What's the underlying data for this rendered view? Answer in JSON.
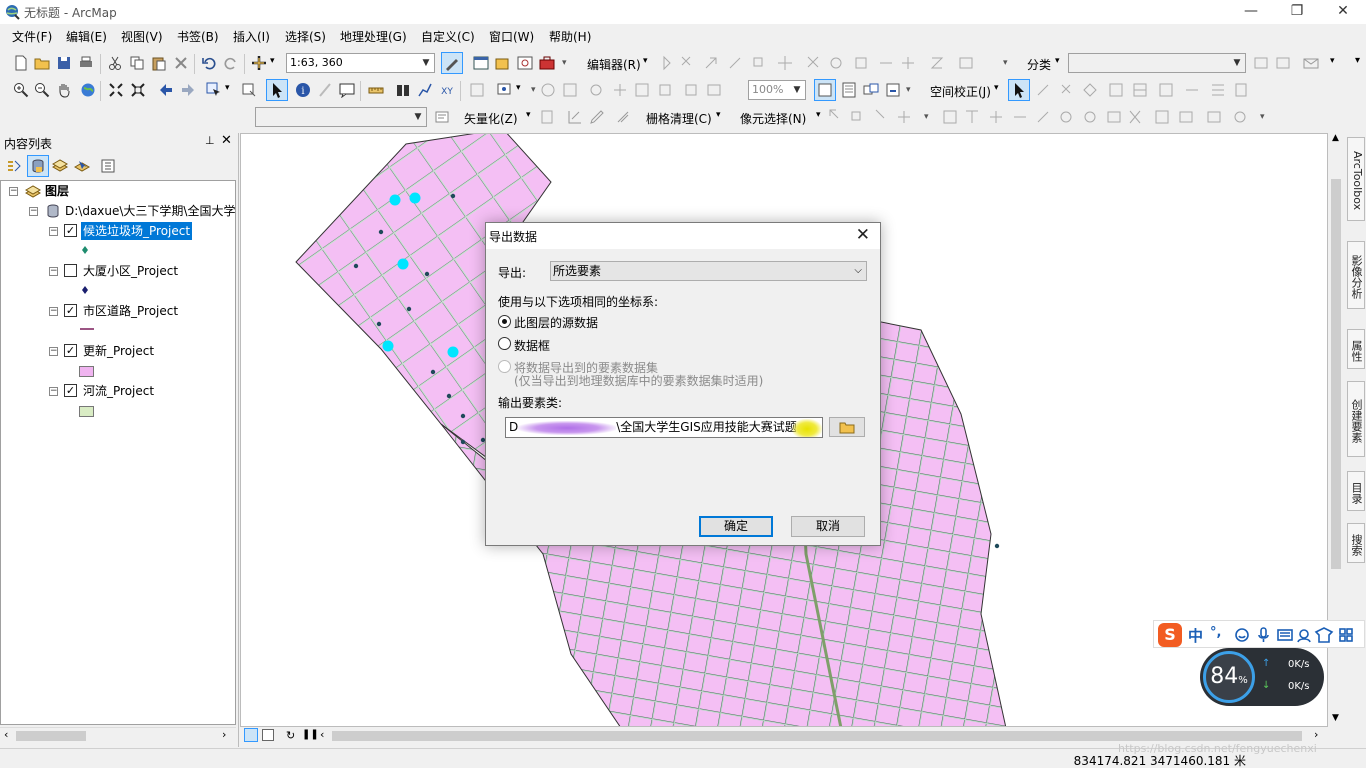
{
  "window": {
    "title": "无标题 - ArcMap"
  },
  "menu": [
    "文件(F)",
    "编辑(E)",
    "视图(V)",
    "书签(B)",
    "插入(I)",
    "选择(S)",
    "地理处理(G)",
    "自定义(C)",
    "窗口(W)",
    "帮助(H)"
  ],
  "toolbar": {
    "scale": "1:63, 360",
    "editor": "编辑器(R)",
    "classify": "分类",
    "zoom_pct": "100%",
    "spatial_adjust": "空间校正(J)",
    "vectorize": "矢量化(Z)",
    "raster_cleanup": "栅格清理(C)",
    "cell_select": "像元选择(N)"
  },
  "toc": {
    "title": "内容列表",
    "root": "图层",
    "path": "D:\\daxue\\大三下学期\\全国大学",
    "layers": [
      {
        "name": "候选垃圾场_Project",
        "checked": true,
        "selected": true,
        "color": "#1e8c6e"
      },
      {
        "name": "大厦小区_Project",
        "checked": false,
        "selected": false,
        "color": "#1a1f6e"
      },
      {
        "name": "市区道路_Project",
        "checked": true,
        "selected": false,
        "color": "#7a1c5a"
      },
      {
        "name": "更新_Project",
        "checked": true,
        "selected": false,
        "color": "#f0b4f0"
      },
      {
        "name": "河流_Project",
        "checked": true,
        "selected": false,
        "color": "#d9ecc4"
      }
    ]
  },
  "dock_tabs": [
    "ArcToolbox",
    "影像分析",
    "属性",
    "创建要素",
    "目录",
    "搜索"
  ],
  "dialog": {
    "title": "导出数据",
    "export_label": "导出:",
    "export_value": "所选要素",
    "coord_label": "使用与以下选项相同的坐标系:",
    "options": [
      {
        "label": "此图层的源数据",
        "selected": true,
        "enabled": true
      },
      {
        "label": "数据框",
        "selected": false,
        "enabled": true
      },
      {
        "label": "将数据导出到的要素数据集",
        "selected": false,
        "enabled": false
      }
    ],
    "option_note": "(仅当导出到地理数据库中的要素数据集时适用)",
    "output_label": "输出要素类:",
    "output_prefix": "D",
    "output_suffix": "\\全国大学生GIS应用技能大赛试题",
    "ok": "确定",
    "cancel": "取消"
  },
  "status": {
    "coords": "834174.821   3471460.181 米"
  },
  "watermark": "https://blog.csdn.net/fengyuechenxi",
  "ime": {
    "icon": "S",
    "lang": "中",
    "punct": "°,"
  },
  "netmon": {
    "percent": "84",
    "unit": "%",
    "up": "0K/s",
    "down": "0K/s"
  }
}
